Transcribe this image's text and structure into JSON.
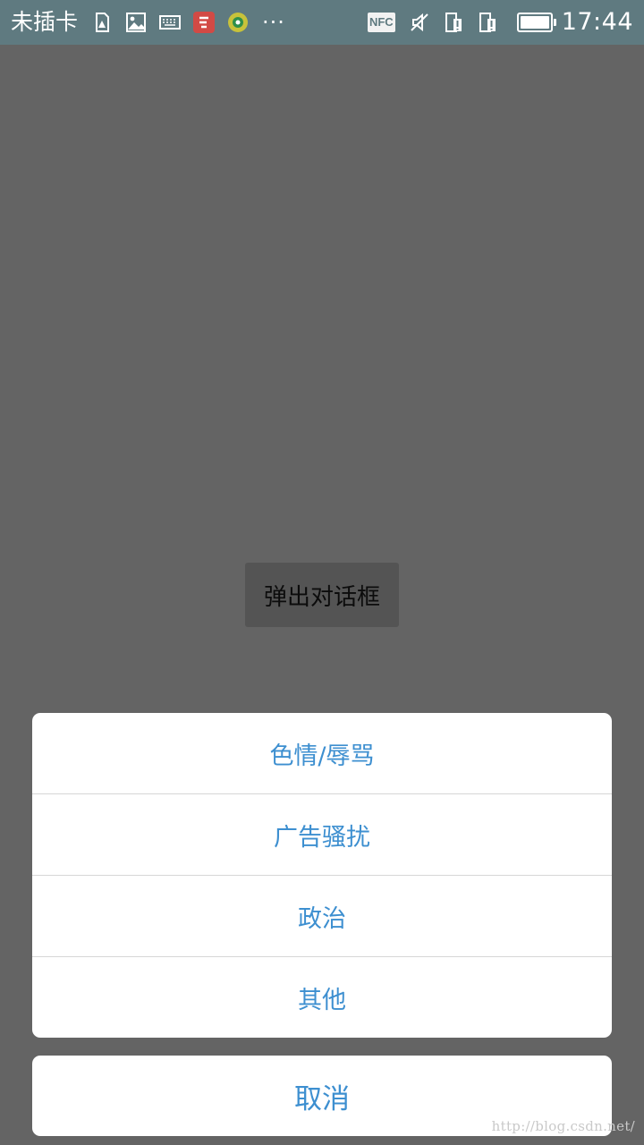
{
  "status_bar": {
    "carrier": "未插卡",
    "left_icons": [
      "sd-card-warning-icon",
      "image-icon",
      "keyboard-icon",
      "app-notification-icon",
      "game-notification-icon"
    ],
    "more": "···",
    "nfc": "NFC",
    "right_icons": [
      "vibrate-off-icon",
      "phone-alert-icon",
      "phone-alert-icon"
    ],
    "battery_level": 1.0,
    "time": "17:44"
  },
  "main": {
    "popup_button_label": "弹出对话框"
  },
  "action_sheet": {
    "items": [
      {
        "label": "色情/辱骂"
      },
      {
        "label": "广告骚扰"
      },
      {
        "label": "政治"
      },
      {
        "label": "其他"
      }
    ],
    "cancel_label": "取消"
  },
  "watermark": "http://blog.csdn.net/",
  "colors": {
    "status_bar_bg": "#5f7a80",
    "dim_overlay": "#646464",
    "accent_text": "#3d8fd0",
    "sheet_bg": "#ffffff"
  }
}
